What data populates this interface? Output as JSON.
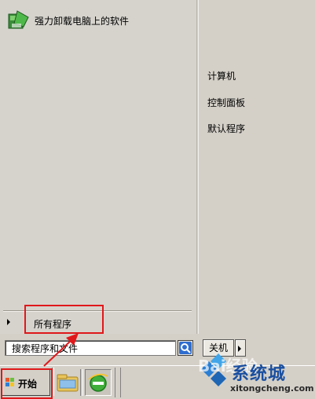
{
  "start_menu": {
    "pinned_items": [
      {
        "label": "强力卸载电脑上的软件",
        "icon": "uninstall-app-icon"
      }
    ],
    "right_items": [
      "计算机",
      "控制面板",
      "默认程序"
    ],
    "all_programs_label": "所有程序",
    "search": {
      "value": "搜索程序和文件",
      "icon": "search-icon"
    },
    "shutdown_label": "关机"
  },
  "taskbar": {
    "start_label": "开始",
    "apps": [
      {
        "name": "windows-explorer-icon"
      },
      {
        "name": "internet-explorer-icon"
      }
    ]
  },
  "watermark": {
    "brand": "系统城",
    "url": "xitongcheng.com",
    "baidu_text": "Bai经验"
  },
  "colors": {
    "highlight": "#e0181b",
    "menu_bg": "#d4d0c8",
    "watermark_blue": "#1a4fa0"
  }
}
